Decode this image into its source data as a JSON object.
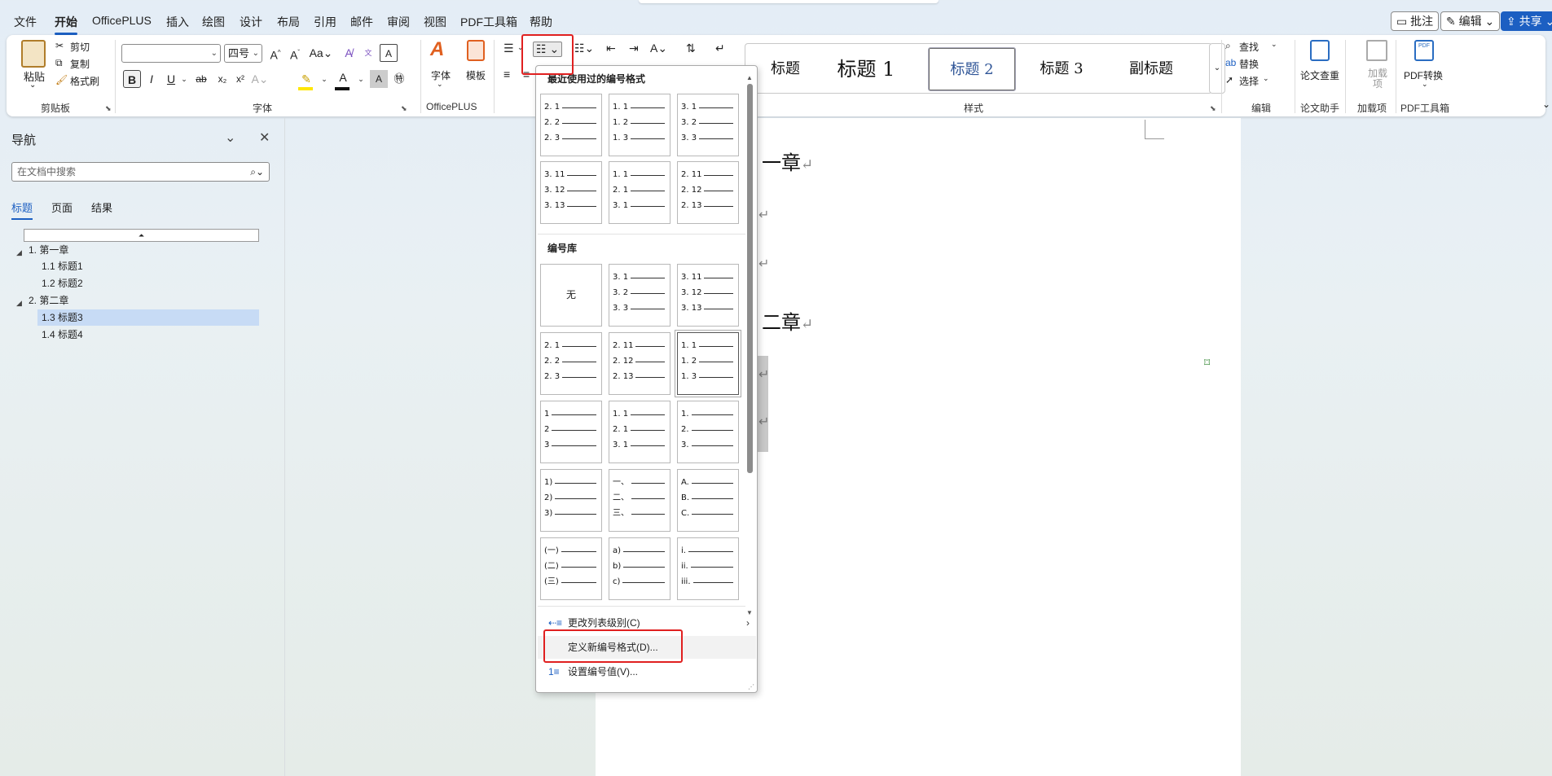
{
  "menu_tabs": [
    "文件",
    "开始",
    "OfficePLUS",
    "插入",
    "绘图",
    "设计",
    "布局",
    "引用",
    "邮件",
    "审阅",
    "视图",
    "PDF工具箱",
    "帮助"
  ],
  "active_tab": "开始",
  "top_right": {
    "comment": "批注",
    "edit": "编辑",
    "share": "共享"
  },
  "ribbon": {
    "clipboard": {
      "paste": "粘贴",
      "cut": "剪切",
      "copy": "复制",
      "format_painter": "格式刷",
      "label": "剪贴板"
    },
    "font": {
      "font_name": "",
      "font_size": "四号",
      "label": "字体"
    },
    "officeplus": {
      "font_btn": "字体",
      "template_btn": "模板",
      "label": "OfficePLUS"
    },
    "styles": {
      "items": [
        "标题",
        "标题 1",
        "标题 2",
        "标题 3",
        "副标题"
      ],
      "selected": "标题 2",
      "label": "样式"
    },
    "editing": {
      "find": "查找",
      "replace": "替换",
      "select": "选择",
      "label": "编辑"
    },
    "paper_check": {
      "btn": "论文查重",
      "label": "论文助手"
    },
    "addins": {
      "btn": "加载项",
      "label": "加载项"
    },
    "pdf": {
      "btn": "PDF转换",
      "label": "PDF工具箱"
    }
  },
  "nav": {
    "title": "导航",
    "search_placeholder": "在文档中搜索",
    "tabs": [
      "标题",
      "页面",
      "结果"
    ],
    "tree": [
      {
        "label": "1. 第一章",
        "level": 0,
        "selected": false
      },
      {
        "label": "1.1 标题1",
        "level": 1,
        "selected": false
      },
      {
        "label": "1.2 标题2",
        "level": 1,
        "selected": false
      },
      {
        "label": "2. 第二章",
        "level": 0,
        "selected": false
      },
      {
        "label": "1.3 标题3",
        "level": 1,
        "selected": true
      },
      {
        "label": "1.4 标题4",
        "level": 1,
        "selected": false
      }
    ]
  },
  "doc": {
    "chapter1": "一章",
    "chapter2": "二章"
  },
  "dropdown": {
    "recent_header": "最近使用过的编号格式",
    "library_header": "编号库",
    "none_label": "无",
    "recent": [
      [
        "2. 1",
        "2. 2",
        "2. 3"
      ],
      [
        "1. 1",
        "1. 2",
        "1. 3"
      ],
      [
        "3. 1",
        "3. 2",
        "3. 3"
      ],
      [
        "3. 11",
        "3. 12",
        "3. 13"
      ],
      [
        "1. 1",
        "2. 1",
        "3. 1"
      ],
      [
        "2. 11",
        "2. 12",
        "2. 13"
      ]
    ],
    "library": [
      null,
      [
        "3. 1",
        "3. 2",
        "3. 3"
      ],
      [
        "3. 11",
        "3. 12",
        "3. 13"
      ],
      [
        "2. 1",
        "2. 2",
        "2. 3"
      ],
      [
        "2. 11",
        "2. 12",
        "2. 13"
      ],
      [
        "1. 1",
        "1. 2",
        "1. 3"
      ],
      [
        "1",
        "2",
        "3"
      ],
      [
        "1. 1",
        "2. 1",
        "3. 1"
      ],
      [
        "1.",
        "2.",
        "3."
      ],
      [
        "1)",
        "2)",
        "3)"
      ],
      [
        "一、",
        "二、",
        "三、"
      ],
      [
        "A.",
        "B.",
        "C."
      ],
      [
        "(一)",
        "(二)",
        "(三)"
      ],
      [
        "a)",
        "b)",
        "c)"
      ],
      [
        "i.",
        "ii.",
        "iii."
      ]
    ],
    "selected_library_index": 5,
    "items": {
      "change_level": "更改列表级别(C)",
      "define_new": "定义新编号格式(D)...",
      "set_value": "设置编号值(V)..."
    }
  }
}
